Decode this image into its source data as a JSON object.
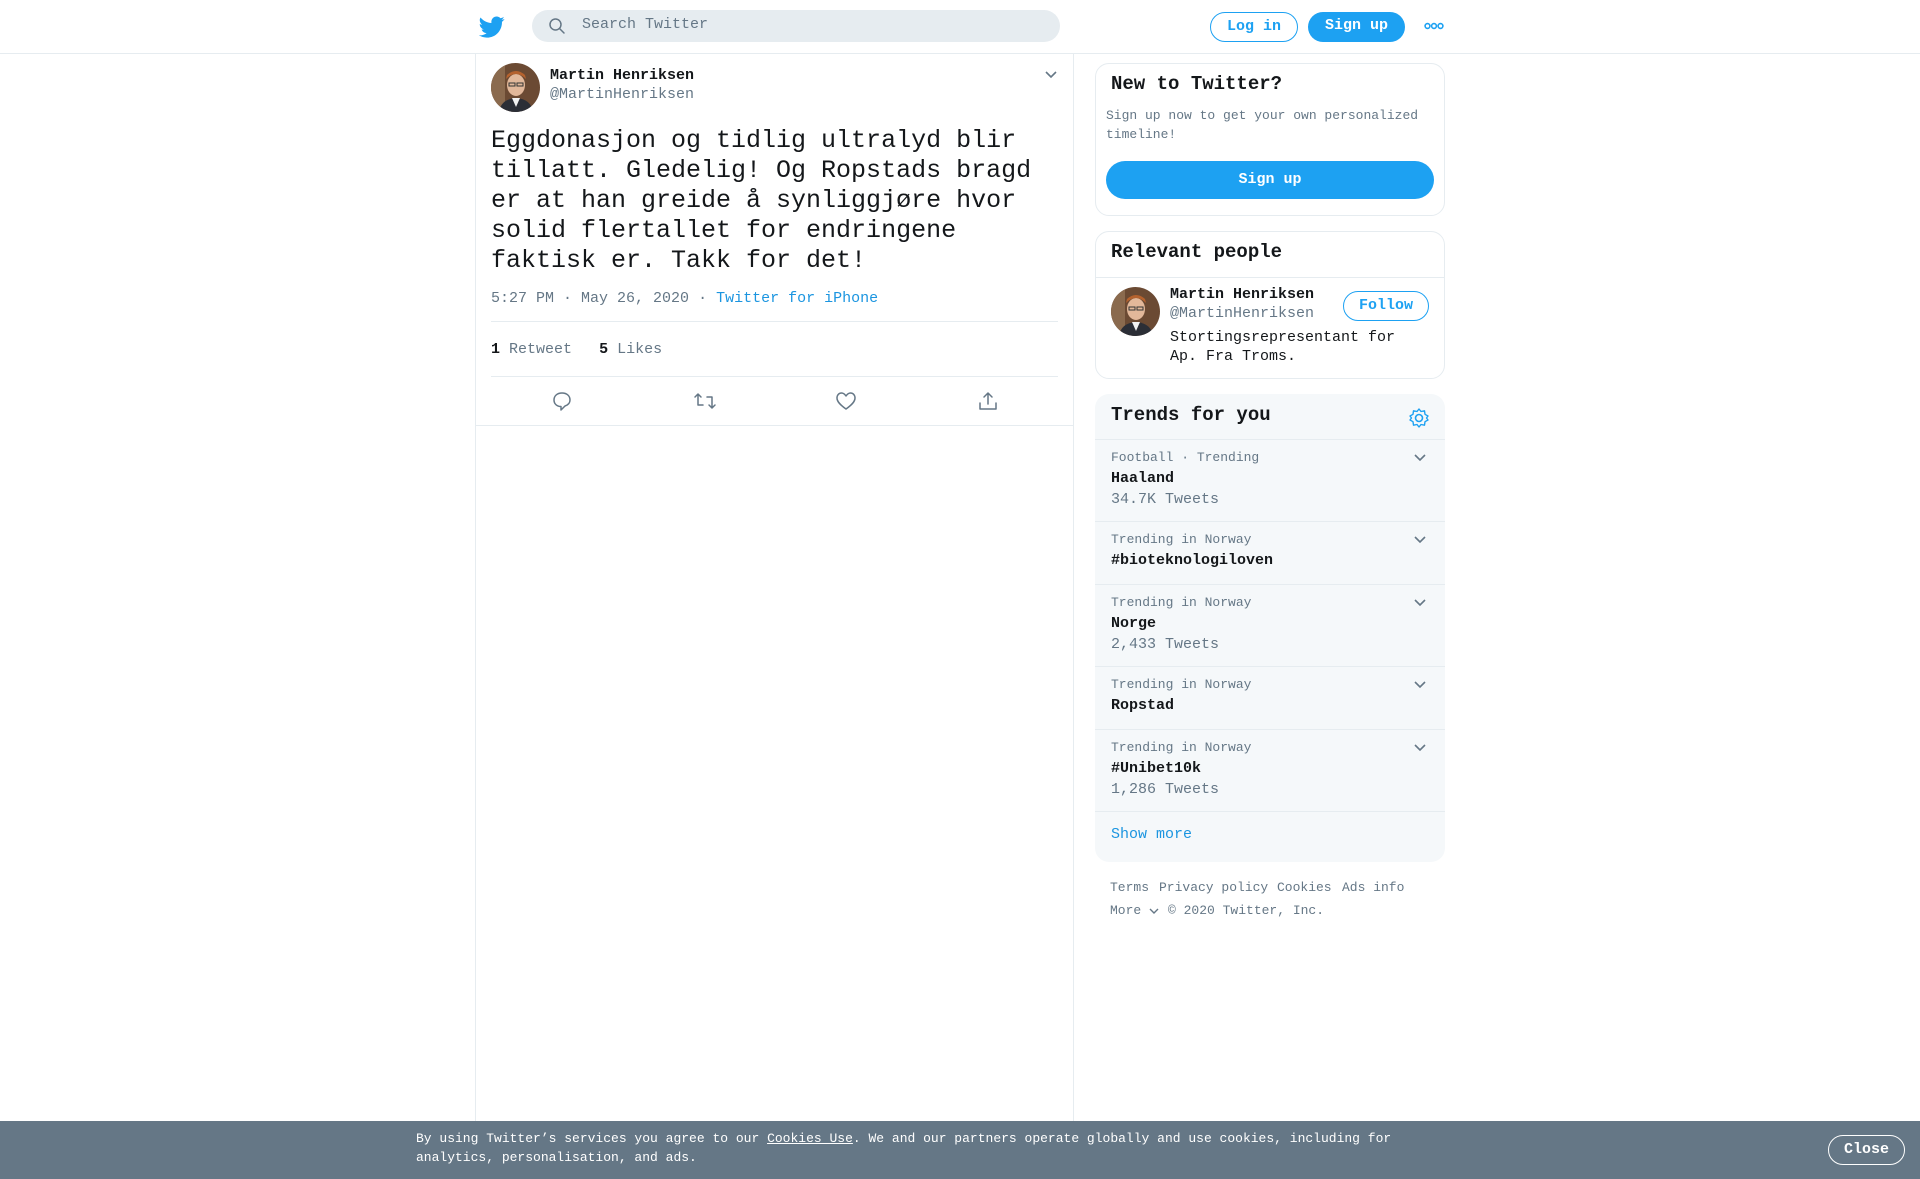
{
  "header": {
    "search_placeholder": "Search Twitter",
    "login_label": "Log in",
    "signup_label": "Sign up"
  },
  "tweet": {
    "author_name": "Martin Henriksen",
    "author_handle": "@MartinHenriksen",
    "text": "Eggdonasjon og tidlig ultralyd blir tillatt. Gledelig! Og Ropstads bragd er at han greide å synliggjøre hvor solid flertallet for endringene faktisk er. Takk for det!",
    "time": "5:27 PM · May 26, 2020",
    "separator": "·",
    "source": "Twitter for iPhone",
    "retweet_count": "1",
    "retweet_label": "Retweet",
    "like_count": "5",
    "like_label": "Likes"
  },
  "new_to_twitter": {
    "title": "New to Twitter?",
    "subtitle": "Sign up now to get your own personalized timeline!",
    "signup_label": "Sign up"
  },
  "relevant_people": {
    "title": "Relevant people",
    "name": "Martin Henriksen",
    "handle": "@MartinHenriksen",
    "follow_label": "Follow",
    "bio": "Stortingsrepresentant for Ap. Fra Troms."
  },
  "trends": {
    "title": "Trends for you",
    "items": [
      {
        "context": "Football · Trending",
        "name": "Haaland",
        "count": "34.7K Tweets"
      },
      {
        "context": "Trending in Norway",
        "name": "#bioteknologiloven",
        "count": ""
      },
      {
        "context": "Trending in Norway",
        "name": "Norge",
        "count": "2,433 Tweets"
      },
      {
        "context": "Trending in Norway",
        "name": "Ropstad",
        "count": ""
      },
      {
        "context": "Trending in Norway",
        "name": "#Unibet10k",
        "count": "1,286 Tweets"
      }
    ],
    "show_more": "Show more"
  },
  "footer": {
    "terms": "Terms",
    "privacy": "Privacy policy",
    "cookies": "Cookies",
    "ads_info": "Ads info",
    "more": "More",
    "copyright": "© 2020 Twitter, Inc."
  },
  "cookie_banner": {
    "text_before": "By using Twitter’s services you agree to our ",
    "link": "Cookies Use",
    "text_after": ". We and our partners operate globally and use cookies, including for analytics, personalisation, and ads.",
    "close_label": "Close"
  },
  "colors": {
    "accent": "#1da1f2",
    "link": "#1b95e0",
    "muted": "#657786",
    "text": "#14171a",
    "banner": "#657786"
  },
  "icons": [
    "twitter-bird-icon",
    "search-icon",
    "more-dots-icon",
    "chevron-down-icon",
    "reply-icon",
    "retweet-icon",
    "like-icon",
    "share-icon",
    "settings-gear-icon"
  ]
}
